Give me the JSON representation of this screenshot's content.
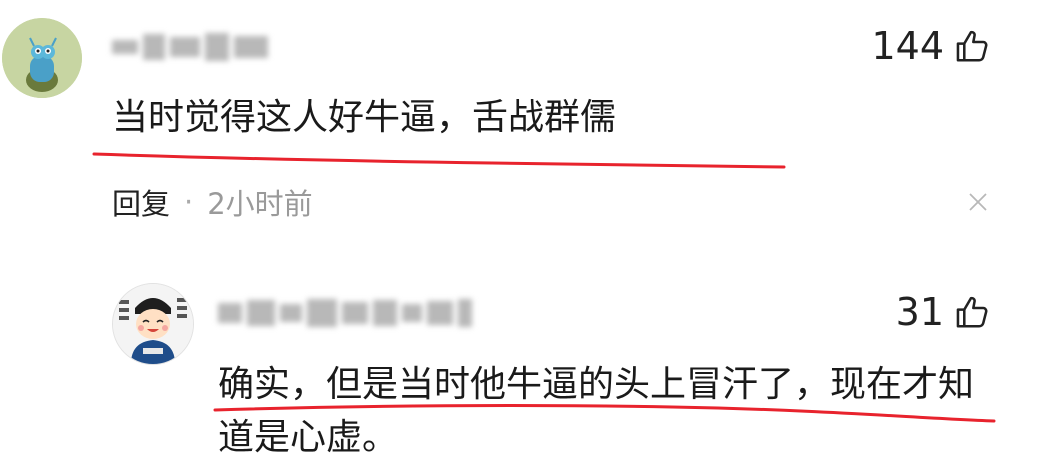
{
  "comment1": {
    "likes": "144",
    "text": "当时觉得这人好牛逼，舌战群儒",
    "reply_label": "回复",
    "separator": "·",
    "time": "2小时前"
  },
  "comment2": {
    "likes": "31",
    "text_line1": "确实，但是当时他牛逼的头上冒汗了，现在才知",
    "text_line2": "道是心虚。"
  },
  "colors": {
    "underline": "#e8232d",
    "avatar1_bg": "#c7d5a2",
    "text": "#222222",
    "meta": "#9a9a9a"
  },
  "icons": [
    "thumbs-up-icon",
    "close-icon"
  ]
}
